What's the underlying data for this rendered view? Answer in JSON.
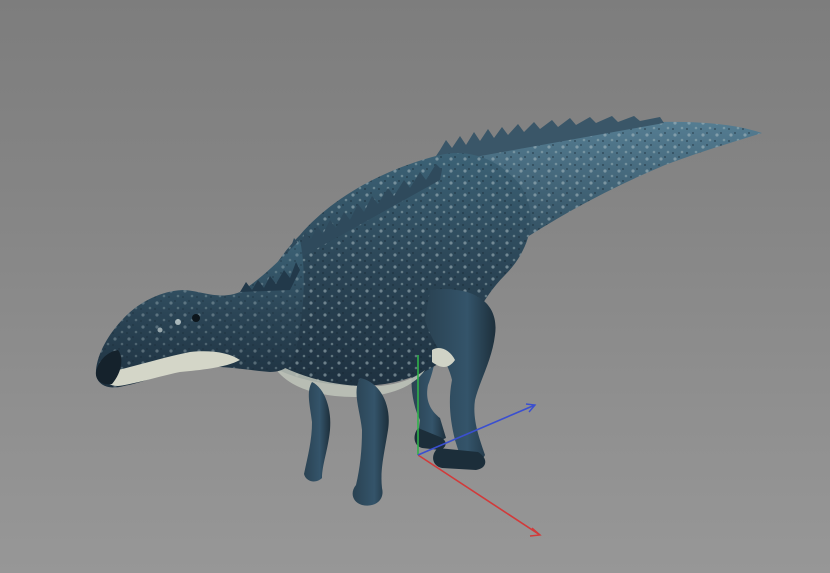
{
  "viewport": {
    "background_top": "#7d7d7d",
    "background_bottom": "#979797"
  },
  "model": {
    "body_color": "#2b4556",
    "body_dark": "#1c2f3c",
    "spot_color": "#9fb5b9",
    "belly_color": "#c9cdc2"
  },
  "gizmo": {
    "axes": [
      {
        "axis": "x",
        "color": "#d23a3a"
      },
      {
        "axis": "y",
        "color": "#2fb24a"
      },
      {
        "axis": "z",
        "color": "#3a4fd0"
      }
    ]
  }
}
